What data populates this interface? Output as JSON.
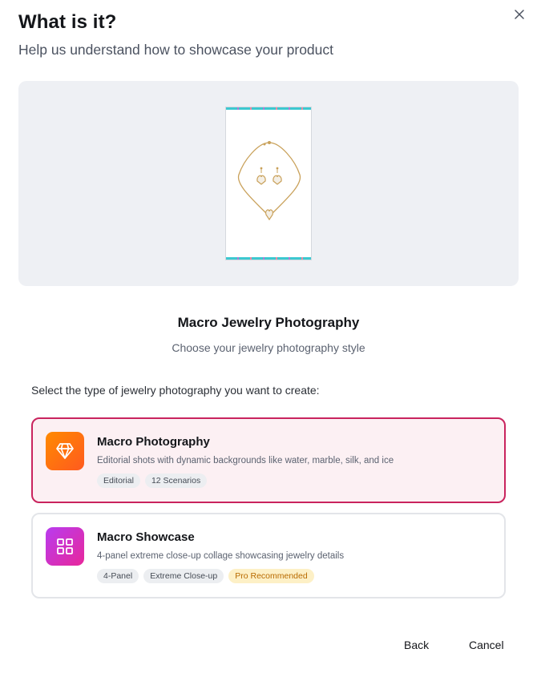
{
  "dialog": {
    "title": "What is it?",
    "subtitle": "Help us understand how to showcase your product",
    "close_icon": "close-icon"
  },
  "preview": {
    "product": "gold necklace and earrings"
  },
  "section": {
    "title": "Macro Jewelry Photography",
    "subtitle": "Choose your jewelry photography style",
    "prompt": "Select the type of jewelry photography you want to create:"
  },
  "options": [
    {
      "title": "Macro Photography",
      "description": "Editorial shots with dynamic backgrounds like water, marble, silk, and ice",
      "icon": "diamond-icon",
      "selected": true,
      "tags": [
        "Editorial",
        "12 Scenarios"
      ]
    },
    {
      "title": "Macro Showcase",
      "description": "4-panel extreme close-up collage showcasing jewelry details",
      "icon": "grid-icon",
      "selected": false,
      "tags": [
        "4-Panel",
        "Extreme Close-up",
        "Pro Recommended"
      ]
    }
  ],
  "footer": {
    "back_label": "Back",
    "cancel_label": "Cancel"
  },
  "colors": {
    "selected_border": "#c9245e",
    "selected_bg": "#fcf0f3",
    "pro_tag_bg": "#fdf0c6",
    "pro_tag_text": "#b86a00"
  }
}
